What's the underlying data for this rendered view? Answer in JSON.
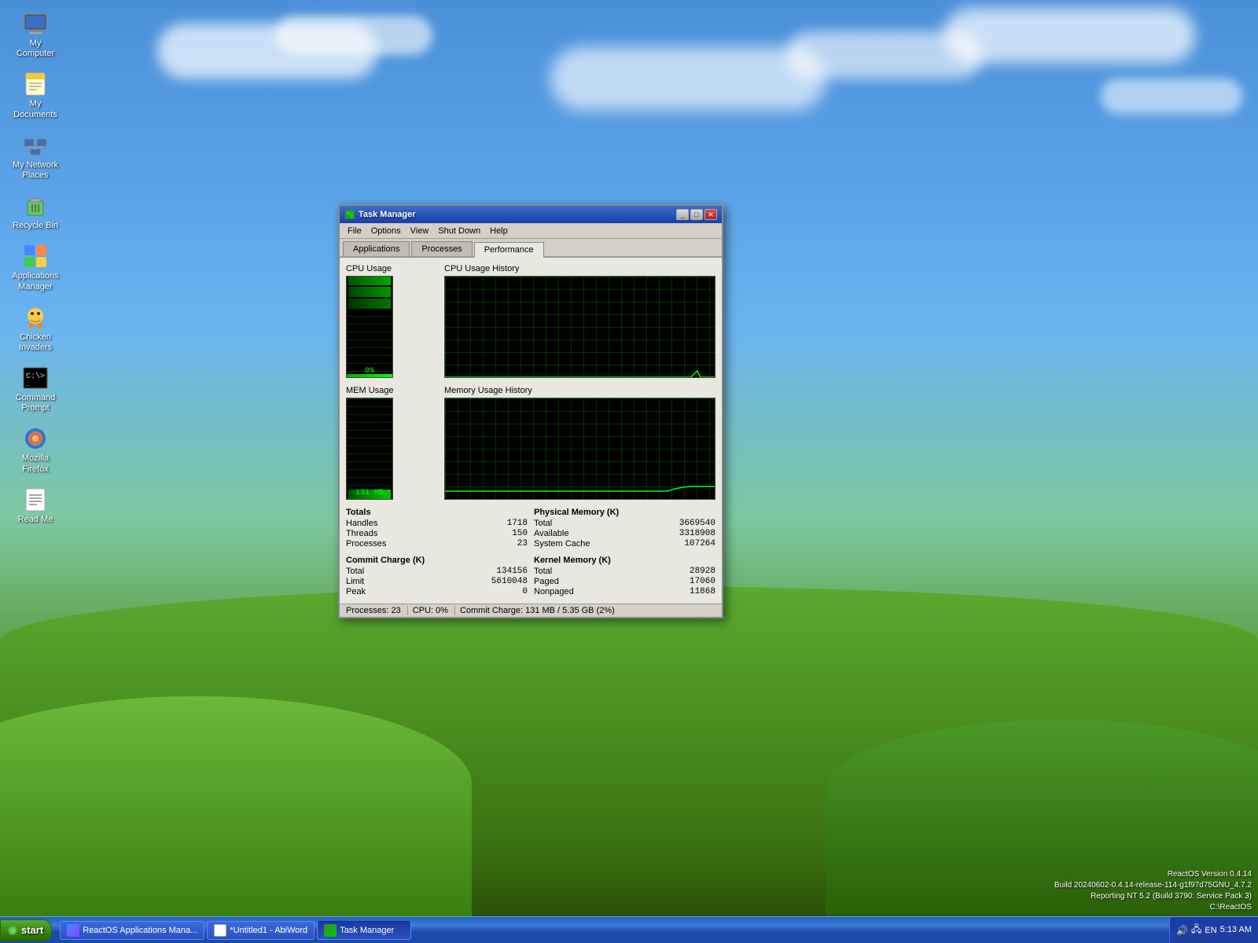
{
  "desktop": {
    "background_desc": "Windows XP style green hills and blue sky"
  },
  "icons": [
    {
      "id": "my-computer",
      "label": "My Computer",
      "icon_type": "computer"
    },
    {
      "id": "my-documents",
      "label": "My Documents",
      "icon_type": "folder"
    },
    {
      "id": "my-network",
      "label": "My Network Places",
      "icon_type": "network"
    },
    {
      "id": "recycle-bin",
      "label": "Recycle Bin",
      "icon_type": "recycle"
    },
    {
      "id": "apps-manager",
      "label": "Applications Manager",
      "icon_type": "apps"
    },
    {
      "id": "chicken-invaders",
      "label": "Chicken Invaders",
      "icon_type": "chicken"
    },
    {
      "id": "command-prompt",
      "label": "Command Prompt",
      "icon_type": "cmd"
    },
    {
      "id": "mozilla-firefox",
      "label": "Mozilla Firefox",
      "icon_type": "ff"
    },
    {
      "id": "read-me",
      "label": "Read Me",
      "icon_type": "doc"
    }
  ],
  "taskmanager": {
    "title": "Task Manager",
    "menu": [
      "File",
      "Options",
      "View",
      "Shut Down",
      "Help"
    ],
    "tabs": [
      "Applications",
      "Processes",
      "Performance"
    ],
    "active_tab": "Performance",
    "sections": {
      "cpu_usage_label": "CPU Usage",
      "cpu_usage_history_label": "CPU Usage History",
      "mem_usage_label": "MEM Usage",
      "mem_usage_history_label": "Memory Usage History",
      "cpu_percent": "0%",
      "mem_mb": "131 MB"
    },
    "totals": {
      "label": "Totals",
      "handles_label": "Handles",
      "handles_val": "1718",
      "threads_label": "Threads",
      "threads_val": "150",
      "processes_label": "Processes",
      "processes_val": "23"
    },
    "commit_charge": {
      "label": "Commit Charge (K)",
      "total_label": "Total",
      "total_val": "134156",
      "limit_label": "Limit",
      "limit_val": "5610048",
      "peak_label": "Peak",
      "peak_val": "0"
    },
    "physical_memory": {
      "label": "Physical Memory (K)",
      "total_label": "Total",
      "total_val": "3669540",
      "available_label": "Available",
      "available_val": "3318908",
      "system_cache_label": "System Cache",
      "system_cache_val": "107264"
    },
    "kernel_memory": {
      "label": "Kernel Memory (K)",
      "total_label": "Total",
      "total_val": "28928",
      "paged_label": "Paged",
      "paged_val": "17060",
      "nonpaged_label": "Nonpaged",
      "nonpaged_val": "11868"
    },
    "statusbar": {
      "processes": "Processes: 23",
      "cpu": "CPU: 0%",
      "commit": "Commit Charge: 131 MB / 5.35 GB (2%)"
    }
  },
  "taskbar": {
    "start_label": "start",
    "items": [
      {
        "id": "apps-manager-tb",
        "label": "ReactOS Applications Mana..."
      },
      {
        "id": "abiword-tb",
        "label": "*Untitled1 - AbiWord"
      },
      {
        "id": "taskmgr-tb",
        "label": "Task Manager"
      }
    ],
    "systray": {
      "time": "5:13 AM",
      "locale": "EN"
    }
  },
  "reactos_info": {
    "line1": "ReactOS Version 0.4.14",
    "line2": "Build 20240602-0.4.14-release-114-g1f97d75GNU_4.7.2",
    "line3": "Reporting NT 5.2 (Build 3790: Service Pack 3)",
    "line4": "C:\\ReactOS"
  }
}
